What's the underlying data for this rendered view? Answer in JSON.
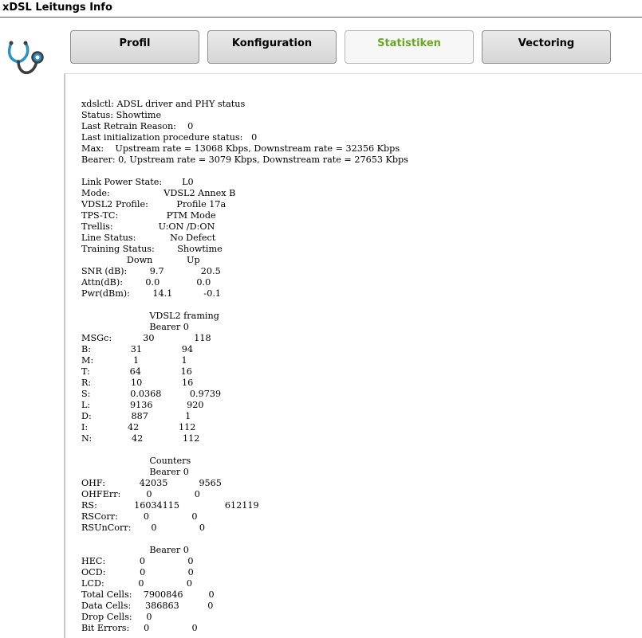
{
  "app": {
    "title": "xDSL Leitungs Info"
  },
  "icons": {
    "logo": "stethoscope-icon"
  },
  "colors": {
    "active_tab_text": "#6aa825",
    "tab_background": "#dcdcdc"
  },
  "tabs": [
    {
      "label": "Profil",
      "active": false
    },
    {
      "label": "Konfiguration",
      "active": false
    },
    {
      "label": "Statistiken",
      "active": true
    },
    {
      "label": "Vectoring",
      "active": false
    }
  ],
  "status_output": "xdslctl: ADSL driver and PHY status\nStatus: Showtime\nLast Retrain Reason:    0\nLast initialization procedure status:   0\nMax:    Upstream rate = 13068 Kbps, Downstream rate = 32356 Kbps\nBearer: 0, Upstream rate = 3079 Kbps, Downstream rate = 27653 Kbps\n\nLink Power State:       L0\nMode:                   VDSL2 Annex B\nVDSL2 Profile:          Profile 17a\nTPS-TC:                 PTM Mode\nTrellis:                U:ON /D:ON\nLine Status:            No Defect\nTraining Status:        Showtime\n                Down            Up\nSNR (dB):        9.7             20.5\nAttn(dB):        0.0             0.0\nPwr(dBm):        14.1           -0.1\n\n                        VDSL2 framing\n                        Bearer 0\nMSGc:           30              118\nB:              31              94\nM:              1               1\nT:              64              16\nR:              10              16\nS:              0.0368          0.9739\nL:              9136            920\nD:              887             1\nI:              42              112\nN:              42              112\n\n                        Counters\n                        Bearer 0\nOHF:            42035           9565\nOHFErr:         0               0\nRS:             16034115                612119\nRSCorr:         0               0\nRSUnCorr:       0               0\n\n                        Bearer 0\nHEC:            0               0\nOCD:            0               0\nLCD:            0               0\nTotal Cells:    7900846         0\nData Cells:     386863          0\nDrop Cells:     0\nBit Errors:     0               0"
}
